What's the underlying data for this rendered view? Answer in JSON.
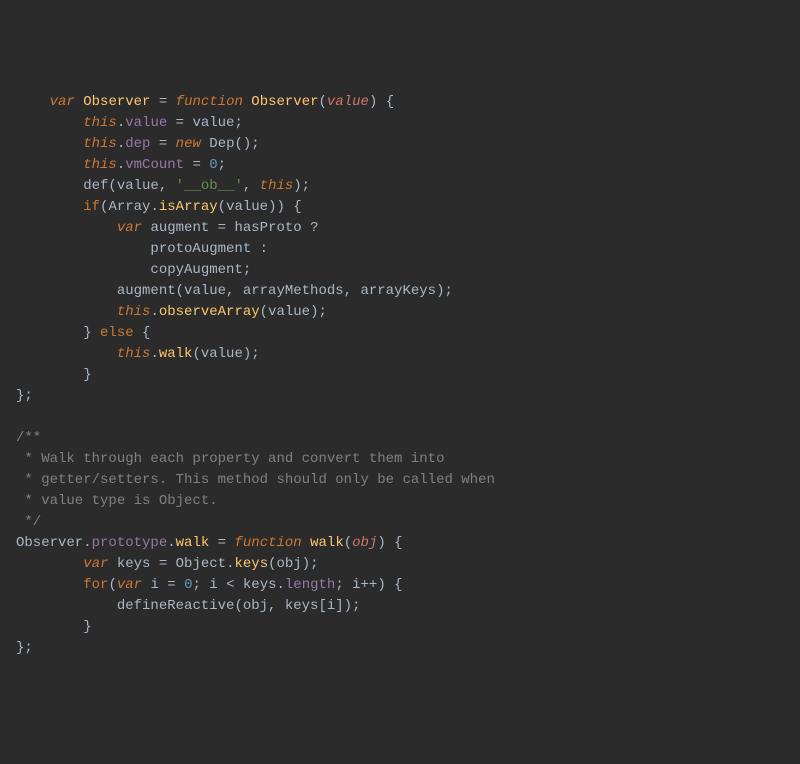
{
  "lines": [
    {
      "indent": 1,
      "segments": [
        {
          "cls": "keyword",
          "t": "var"
        },
        {
          "cls": "punct",
          "t": " "
        },
        {
          "cls": "func-name",
          "t": "Observer"
        },
        {
          "cls": "punct",
          "t": " = "
        },
        {
          "cls": "keyword",
          "t": "function"
        },
        {
          "cls": "punct",
          "t": " "
        },
        {
          "cls": "func-name",
          "t": "Observer"
        },
        {
          "cls": "punct",
          "t": "("
        },
        {
          "cls": "param",
          "t": "value"
        },
        {
          "cls": "punct",
          "t": ") {"
        }
      ]
    },
    {
      "indent": 2,
      "segments": [
        {
          "cls": "this-kw",
          "t": "this"
        },
        {
          "cls": "punct",
          "t": "."
        },
        {
          "cls": "prop",
          "t": "value"
        },
        {
          "cls": "punct",
          "t": " = value;"
        }
      ]
    },
    {
      "indent": 2,
      "segments": [
        {
          "cls": "this-kw",
          "t": "this"
        },
        {
          "cls": "punct",
          "t": "."
        },
        {
          "cls": "prop",
          "t": "dep"
        },
        {
          "cls": "punct",
          "t": " = "
        },
        {
          "cls": "new-kw",
          "t": "new"
        },
        {
          "cls": "punct",
          "t": " Dep();"
        }
      ]
    },
    {
      "indent": 2,
      "segments": [
        {
          "cls": "this-kw",
          "t": "this"
        },
        {
          "cls": "punct",
          "t": "."
        },
        {
          "cls": "prop",
          "t": "vmCount"
        },
        {
          "cls": "punct",
          "t": " = "
        },
        {
          "cls": "number",
          "t": "0"
        },
        {
          "cls": "punct",
          "t": ";"
        }
      ]
    },
    {
      "indent": 2,
      "segments": [
        {
          "cls": "punct",
          "t": "def(value, "
        },
        {
          "cls": "string",
          "t": "'__ob__'"
        },
        {
          "cls": "punct",
          "t": ", "
        },
        {
          "cls": "this-kw",
          "t": "this"
        },
        {
          "cls": "punct",
          "t": ");"
        }
      ]
    },
    {
      "indent": 2,
      "segments": [
        {
          "cls": "keyword-plain",
          "t": "if"
        },
        {
          "cls": "punct",
          "t": "("
        },
        {
          "cls": "global",
          "t": "Array"
        },
        {
          "cls": "punct",
          "t": "."
        },
        {
          "cls": "func-name",
          "t": "isArray"
        },
        {
          "cls": "punct",
          "t": "(value)) {"
        }
      ]
    },
    {
      "indent": 3,
      "segments": [
        {
          "cls": "keyword",
          "t": "var"
        },
        {
          "cls": "punct",
          "t": " augment = hasProto ?"
        }
      ]
    },
    {
      "indent": 4,
      "segments": [
        {
          "cls": "punct",
          "t": "protoAugment :"
        }
      ]
    },
    {
      "indent": 4,
      "segments": [
        {
          "cls": "punct",
          "t": "copyAugment;"
        }
      ]
    },
    {
      "indent": 3,
      "segments": [
        {
          "cls": "punct",
          "t": "augment(value, arrayMethods, arrayKeys);"
        }
      ]
    },
    {
      "indent": 3,
      "segments": [
        {
          "cls": "this-kw",
          "t": "this"
        },
        {
          "cls": "punct",
          "t": "."
        },
        {
          "cls": "func-name",
          "t": "observeArray"
        },
        {
          "cls": "punct",
          "t": "(value);"
        }
      ]
    },
    {
      "indent": 2,
      "segments": [
        {
          "cls": "punct",
          "t": "} "
        },
        {
          "cls": "keyword-plain",
          "t": "else"
        },
        {
          "cls": "punct",
          "t": " {"
        }
      ]
    },
    {
      "indent": 3,
      "segments": [
        {
          "cls": "this-kw",
          "t": "this"
        },
        {
          "cls": "punct",
          "t": "."
        },
        {
          "cls": "func-name",
          "t": "walk"
        },
        {
          "cls": "punct",
          "t": "(value);"
        }
      ]
    },
    {
      "indent": 2,
      "segments": [
        {
          "cls": "punct",
          "t": "}"
        }
      ]
    },
    {
      "indent": 0,
      "segments": [
        {
          "cls": "punct",
          "t": "};"
        }
      ]
    },
    {
      "indent": 0,
      "segments": [
        {
          "cls": "punct",
          "t": ""
        }
      ]
    },
    {
      "indent": 0,
      "segments": [
        {
          "cls": "comment",
          "t": "/**"
        }
      ]
    },
    {
      "indent": 0,
      "segments": [
        {
          "cls": "comment",
          "t": " * Walk through each property and convert them into"
        }
      ]
    },
    {
      "indent": 0,
      "segments": [
        {
          "cls": "comment",
          "t": " * getter/setters. This method should only be called when"
        }
      ]
    },
    {
      "indent": 0,
      "segments": [
        {
          "cls": "comment",
          "t": " * value type is Object."
        }
      ]
    },
    {
      "indent": 0,
      "segments": [
        {
          "cls": "comment",
          "t": " */"
        }
      ]
    },
    {
      "indent": 0,
      "segments": [
        {
          "cls": "punct",
          "t": "Observer."
        },
        {
          "cls": "prop",
          "t": "prototype"
        },
        {
          "cls": "punct",
          "t": "."
        },
        {
          "cls": "func-name",
          "t": "walk"
        },
        {
          "cls": "punct",
          "t": " = "
        },
        {
          "cls": "keyword",
          "t": "function"
        },
        {
          "cls": "punct",
          "t": " "
        },
        {
          "cls": "func-name",
          "t": "walk"
        },
        {
          "cls": "punct",
          "t": "("
        },
        {
          "cls": "param",
          "t": "obj"
        },
        {
          "cls": "punct",
          "t": ") {"
        }
      ]
    },
    {
      "indent": 2,
      "segments": [
        {
          "cls": "keyword",
          "t": "var"
        },
        {
          "cls": "punct",
          "t": " keys = "
        },
        {
          "cls": "global",
          "t": "Object"
        },
        {
          "cls": "punct",
          "t": "."
        },
        {
          "cls": "func-name",
          "t": "keys"
        },
        {
          "cls": "punct",
          "t": "(obj);"
        }
      ]
    },
    {
      "indent": 2,
      "segments": [
        {
          "cls": "keyword-plain",
          "t": "for"
        },
        {
          "cls": "punct",
          "t": "("
        },
        {
          "cls": "keyword",
          "t": "var"
        },
        {
          "cls": "punct",
          "t": " i = "
        },
        {
          "cls": "number",
          "t": "0"
        },
        {
          "cls": "punct",
          "t": "; i < keys."
        },
        {
          "cls": "prop",
          "t": "length"
        },
        {
          "cls": "punct",
          "t": "; i++) {"
        }
      ]
    },
    {
      "indent": 3,
      "segments": [
        {
          "cls": "punct",
          "t": "defineReactive(obj, keys[i]);"
        }
      ]
    },
    {
      "indent": 2,
      "segments": [
        {
          "cls": "punct",
          "t": "}"
        }
      ]
    },
    {
      "indent": 0,
      "segments": [
        {
          "cls": "punct",
          "t": "};"
        }
      ]
    }
  ]
}
